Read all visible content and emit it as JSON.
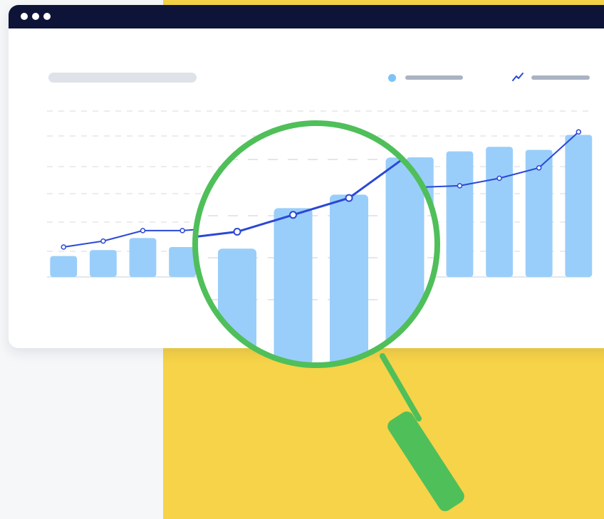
{
  "colors": {
    "background": "#f6f7f9",
    "panel": "#f6d348",
    "titlebar": "#0d1438",
    "bar": "#99cefa",
    "line": "#2a48d6",
    "magnifier": "#4fbf5a",
    "placeholder": "#dfe2e8"
  },
  "window": {
    "controls": [
      "window-dot-icon",
      "window-dot-icon",
      "window-dot-icon"
    ]
  },
  "legend": {
    "items": [
      {
        "icon": "circle-marker-icon"
      },
      {
        "icon": "line-trend-icon"
      }
    ]
  },
  "chart_data": {
    "type": "bar",
    "title": "",
    "xlabel": "",
    "ylabel": "",
    "ylim": [
      0,
      100
    ],
    "grid": true,
    "legend_position": "top-right",
    "series": [
      {
        "type": "bar",
        "values": [
          14,
          18,
          26,
          20,
          28,
          40,
          44,
          55,
          60,
          80,
          84,
          87,
          85,
          95
        ]
      },
      {
        "type": "line",
        "values": [
          20,
          24,
          31,
          31,
          33,
          38,
          43,
          55,
          60,
          60,
          61,
          66,
          73,
          97
        ]
      }
    ],
    "magnified_range": [
      4,
      8
    ],
    "icons": [
      "magnifying-glass-icon"
    ]
  }
}
